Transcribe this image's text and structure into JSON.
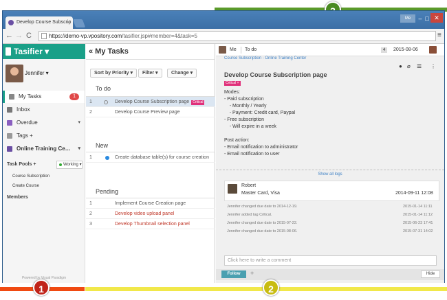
{
  "browser": {
    "tab_title": "Develop Course Subscrip",
    "tab_close": "×",
    "user_badge": "Me",
    "minimize": "–",
    "maximize": "□",
    "close": "✕",
    "back": "←",
    "forward": "→",
    "reload": "C",
    "url_host": "https://demo-vp.vpository.com",
    "url_path": "/tasifier.jsp#member=4&task=5",
    "menu": "≡"
  },
  "sidebar": {
    "brand": "Tasifier ▾",
    "user": "Jennifer ▾",
    "items": [
      {
        "label": "My Tasks",
        "badge": "1"
      },
      {
        "label": "Inbox"
      },
      {
        "label": "Overdue",
        "caret": "▾"
      },
      {
        "label": "Tags +"
      },
      {
        "label": "Online Training Ce…",
        "caret": "▾"
      }
    ],
    "task_pools_label": "Task Pools +",
    "working": "Working ▾",
    "pools": [
      "Course Subscription",
      "Create Course"
    ],
    "members_label": "Members",
    "powered": "Powered by Visual Paradigm"
  },
  "middle": {
    "title": "« My Tasks",
    "filters": [
      "Sort by Priority ▾",
      "Filter ▾",
      "Change ▾"
    ],
    "groups": [
      {
        "name": "To do",
        "tasks": [
          {
            "num": "1",
            "label": "Develop Course Subscription page",
            "tag": "Critical"
          },
          {
            "num": "2",
            "label": "Develop Course Preview page"
          }
        ]
      },
      {
        "name": "New",
        "tasks": [
          {
            "num": "1",
            "label": "Create database table(s) for course creation"
          }
        ]
      },
      {
        "name": "Pending",
        "tasks": [
          {
            "num": "1",
            "label": "Implement Course Creation page"
          },
          {
            "num": "2",
            "label": "Develop video upload panel"
          },
          {
            "num": "3",
            "label": "Develop Thumbnail selection panel"
          }
        ]
      }
    ]
  },
  "detail": {
    "assignee": "Me",
    "status": "To do",
    "count": "4",
    "due": "2015-08-06",
    "breadcrumb": "Course Subscription - Online Training Center",
    "title": "Develop Course Subscription page",
    "tag": "Critical ×",
    "description": "Modes:\n- Paid subscription\n    - Monthly / Yearly\n    - Payment: Credit card, Paypal\n- Free subscription\n    - Will expire in a week\n\nPost action:\n- Email notification to administrator\n- Email notification to user",
    "show_logs": "Show all logs",
    "comment": {
      "author": "Robert",
      "text": "Master Card, Visa",
      "time": "2014-09-11 12:08"
    },
    "logs": [
      {
        "text": "Jennifer changed due date to 2014-12-19.",
        "time": "2015-01-14 11:11"
      },
      {
        "text": "Jennifer added tag Critical.",
        "time": "2015-01-14 11:12"
      },
      {
        "text": "Jennifer changed due date to 2015-07-22.",
        "time": "2015-06-23 17:41"
      },
      {
        "text": "Jennifer changed due date to 2015-08-06.",
        "time": "2015-07-31 14:02"
      }
    ],
    "comment_placeholder": "Click here to write a comment",
    "follow": "Follow",
    "add": "+",
    "hide": "Hide"
  },
  "annotations": [
    "1",
    "2",
    "3"
  ],
  "colors": {
    "brand": "#1aa088",
    "critical": "#e0307a",
    "bar1": "#f04a12",
    "bar2": "#f1e84a",
    "bar3": "#5a9a2a"
  }
}
